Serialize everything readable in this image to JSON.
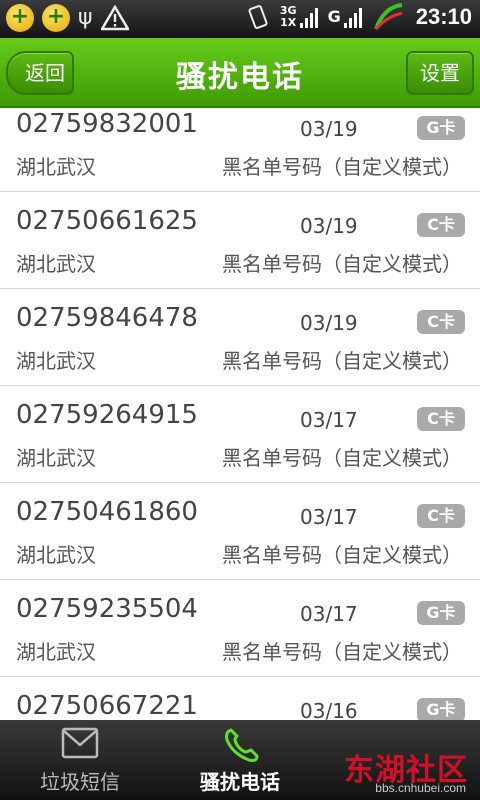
{
  "status_bar": {
    "network_top": "3G",
    "network_bottom": "1X",
    "network_g": "G",
    "time": "23:10"
  },
  "header": {
    "back_label": "返回",
    "title": "骚扰电话",
    "settings_label": "设置"
  },
  "list": [
    {
      "number": "02759832001",
      "date": "03/19",
      "card": "G卡",
      "location": "湖北武汉",
      "tag": "黑名单号码（自定义模式）"
    },
    {
      "number": "02750661625",
      "date": "03/19",
      "card": "C卡",
      "location": "湖北武汉",
      "tag": "黑名单号码（自定义模式）"
    },
    {
      "number": "02759846478",
      "date": "03/19",
      "card": "C卡",
      "location": "湖北武汉",
      "tag": "黑名单号码（自定义模式）"
    },
    {
      "number": "02759264915",
      "date": "03/17",
      "card": "C卡",
      "location": "湖北武汉",
      "tag": "黑名单号码（自定义模式）"
    },
    {
      "number": "02750461860",
      "date": "03/17",
      "card": "C卡",
      "location": "湖北武汉",
      "tag": "黑名单号码（自定义模式）"
    },
    {
      "number": "02759235504",
      "date": "03/17",
      "card": "G卡",
      "location": "湖北武汉",
      "tag": "黑名单号码（自定义模式）"
    },
    {
      "number": "02750667221",
      "date": "03/16",
      "card": "G卡",
      "location": "",
      "tag": ""
    }
  ],
  "bottom_nav": {
    "items": [
      {
        "label": "垃圾短信",
        "icon": "envelope-icon",
        "active": false
      },
      {
        "label": "骚扰电话",
        "icon": "phone-icon",
        "active": true
      }
    ]
  },
  "watermark": {
    "text": "东湖社区",
    "url": "bbs.cnhubei.com"
  },
  "colors": {
    "header_green": "#4fb30d",
    "card_gray": "#a9a9a9",
    "watermark_red": "#d1102a"
  }
}
